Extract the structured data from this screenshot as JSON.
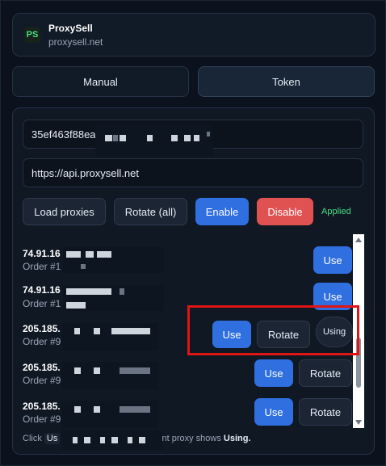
{
  "header": {
    "logo": "PS",
    "title": "ProxySell",
    "domain": "proxysell.net"
  },
  "tabs": [
    {
      "label": "Manual",
      "active": false
    },
    {
      "label": "Token",
      "active": true
    }
  ],
  "form": {
    "token_value": "35ef463f88ea",
    "api_url": "https://api.proxysell.net"
  },
  "actions": {
    "load": "Load proxies",
    "rotate_all": "Rotate (all)",
    "enable": "Enable",
    "disable": "Disable",
    "status": "Applied"
  },
  "proxies": [
    {
      "ip": "74.91.16",
      "order": "Order #1",
      "use": "Use"
    },
    {
      "ip": "74.91.16",
      "order": "Order #1",
      "use": "Use"
    },
    {
      "ip": "205.185.",
      "order": "Order #9",
      "use": "Use",
      "rotate": "Rotate",
      "state": "Using"
    },
    {
      "ip": "205.185.",
      "order": "Order #9",
      "use": "Use",
      "rotate": "Rotate"
    },
    {
      "ip": "205.185.",
      "order": "Order #9",
      "use": "Use",
      "rotate": "Rotate"
    }
  ],
  "footer": {
    "prefix": "Click",
    "chip": "Us",
    "suffix": "nt proxy shows",
    "emph": "Using."
  },
  "colors": {
    "accent": "#2f6fe0",
    "danger": "#e05252",
    "success": "#4ade80",
    "highlight": "#e01515"
  }
}
